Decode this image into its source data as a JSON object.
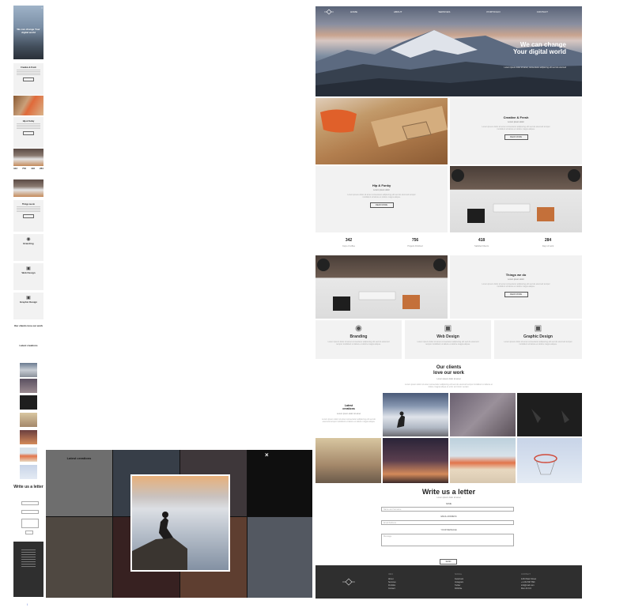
{
  "mobile": {
    "hero_title": "We can change Your digital world",
    "close": "×",
    "sections": [
      {
        "title": "Creative & Fresh",
        "button": "Read More"
      },
      {
        "title": "Hip & Funky",
        "button": "Read More"
      },
      {
        "title": "Things we do",
        "button": "Read More"
      }
    ],
    "stats": [
      "342",
      "756",
      "418",
      "284"
    ],
    "services": [
      {
        "icon": "eye-icon",
        "glyph": "◉",
        "title": "Branding"
      },
      {
        "icon": "monitor-icon",
        "glyph": "▣",
        "title": "Web Design"
      },
      {
        "icon": "image-icon",
        "glyph": "▣",
        "title": "Graphic Design"
      }
    ],
    "clients_title": "Our clients love our work",
    "latest_title": "Latest creations",
    "write_title": "Write us a letter",
    "page_indicator": "!"
  },
  "lightbox": {
    "close": "×",
    "caption": "Latest creations"
  },
  "desktop": {
    "nav": [
      "HOME",
      "ABOUT",
      "SERVICES",
      "PORTFOLIO",
      "CONTACT"
    ],
    "hero": {
      "title_line1": "We can change",
      "title_line2": "Your digital world",
      "subtitle": "Lorem ipsum dolor sit amet, consectetur adipiscing elit sed do eiusmod"
    },
    "creative": {
      "title": "Creative & Fresh",
      "sub": "Lorem ipsum dolor",
      "text": "Lorem ipsum dolor sit amet consectetur adipiscing elit sed do eiusmod tempor incididunt ut labore et dolore magna aliqua.",
      "button": "READ MORE"
    },
    "hip": {
      "title": "Hip & Funky",
      "sub": "Lorem ipsum dolor",
      "text": "Lorem ipsum dolor sit amet consectetur adipiscing elit sed do eiusmod tempor incididunt ut labore et dolore magna aliqua.",
      "button": "READ MORE"
    },
    "things": {
      "title": "Things we do",
      "sub": "Lorem ipsum dolor",
      "text": "Lorem ipsum dolor sit amet consectetur adipiscing elit sed do eiusmod tempor incididunt ut labore et dolore magna aliqua.",
      "button": "READ MORE"
    },
    "stats": [
      {
        "value": "342",
        "caption": "Cups of coffee"
      },
      {
        "value": "756",
        "caption": "Projects Finished"
      },
      {
        "value": "418",
        "caption": "Satisfied Clients"
      },
      {
        "value": "284",
        "caption": "Days of work"
      }
    ],
    "services": [
      {
        "icon": "eye-icon",
        "glyph": "◉",
        "title": "Branding",
        "text": "Lorem ipsum dolor sit amet consectetur adipiscing elit sed do eiusmod tempor incididunt ut labore et dolore magna aliqua."
      },
      {
        "icon": "monitor-icon",
        "glyph": "▣",
        "title": "Web Design",
        "text": "Lorem ipsum dolor sit amet consectetur adipiscing elit sed do eiusmod tempor incididunt ut labore et dolore magna aliqua."
      },
      {
        "icon": "image-icon",
        "glyph": "▣",
        "title": "Graphic Design",
        "text": "Lorem ipsum dolor sit amet consectetur adipiscing elit sed do eiusmod tempor incididunt ut labore et dolore magna aliqua."
      }
    ],
    "clients": {
      "title_line1": "Our clients",
      "title_line2": "love our work",
      "sub": "Lorem ipsum dolor sit amet",
      "text": "Lorem ipsum dolor sit amet consectetur adipiscing elit sed do eiusmod tempor incididunt ut labore et dolore magna aliqua ut enim ad minim veniam."
    },
    "latest": {
      "title_line1": "Latest",
      "title_line2": "creations",
      "sub": "Lorem ipsum dolor sit amet",
      "text": "Lorem ipsum dolor sit amet consectetur adipiscing elit sed do eiusmod tempor incididunt ut labore et dolore magna aliqua."
    },
    "write": {
      "title": "Write us a letter",
      "sub": "Lorem ipsum dolor sit amet",
      "name_label": "NAME",
      "name_placeholder": "Name and Surname",
      "email_label": "EMAIL ADDRESS",
      "email_placeholder": "Email Address",
      "message_label": "YOUR MESSAGE",
      "message_placeholder": "Message",
      "send": "SEND"
    },
    "footer": {
      "col1_title": "INFO",
      "col1": [
        "About",
        "Services",
        "Portfolio",
        "Contact"
      ],
      "col2_title": "SOCIAL",
      "col2": [
        "Facebook",
        "Instagram",
        "Twitter",
        "Dribbble"
      ],
      "col3_title": "CONTACT",
      "col3": [
        "1234 Main Street",
        "+1 234 567 890",
        "info@mail.com",
        "Mon-Fri 9-5"
      ]
    }
  }
}
